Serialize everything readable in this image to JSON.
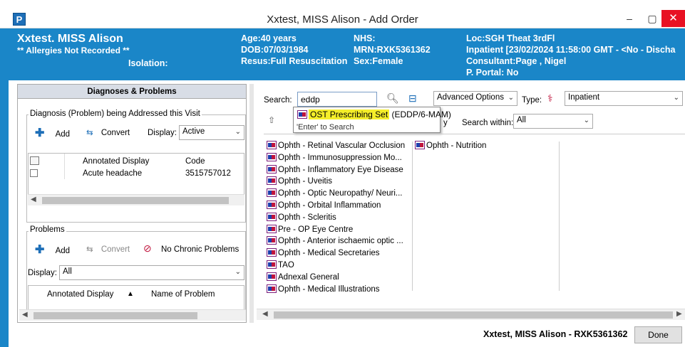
{
  "window": {
    "title": "Xxtest, MISS Alison - Add Order",
    "app_icon": "P",
    "minimize": "‒",
    "maximize": "▢",
    "close": "✕"
  },
  "banner": {
    "patient_name": "Xxtest. MISS Alison",
    "allergies": "** Allergies Not Recorded **",
    "isolation": "Isolation:",
    "age": "Age:40 years",
    "dob": "DOB:07/03/1984",
    "resus": "Resus:Full Resuscitation",
    "nhs": "NHS:",
    "mrn": "MRN:RXK5361362",
    "sex": "Sex:Female",
    "loc": "Loc:SGH Theat 3rdFl",
    "inpatient": "Inpatient [23/02/2024 11:58:00 GMT - <No - Discha",
    "consultant": "Consultant:Page , Nigel",
    "portal": "P. Portal: No"
  },
  "left_panel": {
    "header": "Diagnoses & Problems",
    "diagnosis_group": "Diagnosis (Problem) being Addressed this Visit",
    "add_label": "Add",
    "convert_label": "Convert",
    "display_label": "Display:",
    "display_value": "Active",
    "grid_headers": [
      "Annotated Display",
      "Code"
    ],
    "grid_rows": [
      {
        "display": "Acute headache",
        "code": "3515757012"
      }
    ],
    "problems_group": "Problems",
    "problems_add": "Add",
    "problems_convert": "Convert",
    "no_chronic": "No Chronic Problems",
    "problems_display_label": "Display:",
    "problems_display_value": "All",
    "problems_headers": [
      "Annotated Display",
      "Name of Problem"
    ]
  },
  "right_panel": {
    "search_label": "Search:",
    "search_value": "eddp",
    "advanced_options": "Advanced Options",
    "type_label": "Type:",
    "type_value": "Inpatient",
    "suggestion_highlight": "OST Prescribing Set",
    "suggestion_rest": " (EDDP/6-MAM)",
    "suggestion_hint": "'Enter' to Search",
    "partial_y": "y",
    "search_within_label": "Search within:",
    "search_within_value": "All",
    "folders_col1": [
      "Ophth - Retinal Vascular Occlusion",
      "Ophth - Immunosuppression Mo...",
      "Ophth - Inflammatory Eye Disease",
      "Ophth - Uveitis",
      "Ophth - Optic Neuropathy/ Neuri...",
      "Ophth - Orbital Inflammation",
      "Ophth - Scleritis",
      "Pre - OP Eye Centre",
      "Ophth - Anterior ischaemic optic ...",
      "Ophth - Medical Secretaries",
      "TAO",
      "Adnexal General",
      "Ophth - Medical Illustrations"
    ],
    "folders_col2": [
      "Ophth - Nutrition"
    ]
  },
  "footer": {
    "patient_summary": "Xxtest, MISS Alison - RXK5361362",
    "done_label": "Done"
  }
}
